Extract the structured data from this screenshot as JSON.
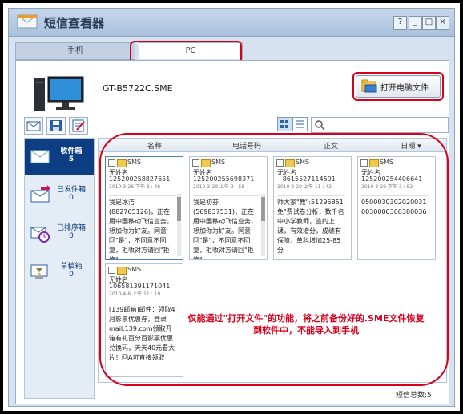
{
  "window": {
    "title": "短信查看器",
    "help": "?",
    "minimize": "_",
    "maximize": "□",
    "close": "×"
  },
  "tabs": [
    {
      "label": "手机"
    },
    {
      "label": "PC"
    }
  ],
  "device": {
    "name": "GT-B5722C.SME"
  },
  "open_button": {
    "label": "打开电脑文件"
  },
  "search": {
    "placeholder": ""
  },
  "sidebar": [
    {
      "label": "收件箱",
      "count": "5"
    },
    {
      "label": "已发件箱",
      "count": "0"
    },
    {
      "label": "已排序箱",
      "count": "0"
    },
    {
      "label": "草稿箱",
      "count": "0"
    }
  ],
  "columns": [
    "名称",
    "电话号码",
    "正文",
    "日期 ▾"
  ],
  "messages": [
    {
      "type": "SMS",
      "name": "无姓名",
      "number": "125200258827651",
      "time": "2010-3-26 下午 3 : 46",
      "body": "我是冰洁(882765126)，正在用中国移动飞信业务，想加你为好友。同意回\"是\"，不同意不回复，拒收对方请回\"拒绝\""
    },
    {
      "type": "SMS",
      "name": "无姓名",
      "number": "125200255698371",
      "time": "2010-3-29 上午 9 : 58",
      "body": "我是初芬(569837531)，正在用中国移动飞信业务，想加你为好友。同意回\"是\"，不同意不回复，拒收对方请回\"拒绝\""
    },
    {
      "type": "SMS",
      "name": "无姓名",
      "number": "+8615527114591",
      "time": "2010-3-29 上午 11 : 42",
      "body": "师大家\"教\":51296851免\"费试卷分析，数千名中小学教师，签约上课，有效增分，成绩有保障，单科增加25-85分"
    },
    {
      "type": "SMS",
      "name": "无姓名",
      "number": "125200254406641",
      "time": "2010-3-29 下午 3 : 52",
      "body": "05000303020200310030000300380036"
    },
    {
      "type": "SMS",
      "name": "无姓名",
      "number": "106581391171041",
      "time": "2010-4-6 上午 11 : 19",
      "body": "[139邮箱]邮件：领取4月影票优惠券，登录mail.139.com领取开箱有礼百分百影票优惠兑换码，天天40元看大片！回A可直接领取"
    }
  ],
  "annotation": "仅能通过\"打开文件\"的功能，将之前备份好的.SME文件恢复到软件中，不能导入到手机",
  "status": {
    "total": "短信总数:5"
  },
  "colors": {
    "highlight": "#d6001c",
    "sidebar_selected": "#0d3e84",
    "window_bg": "#d6e2ef"
  }
}
